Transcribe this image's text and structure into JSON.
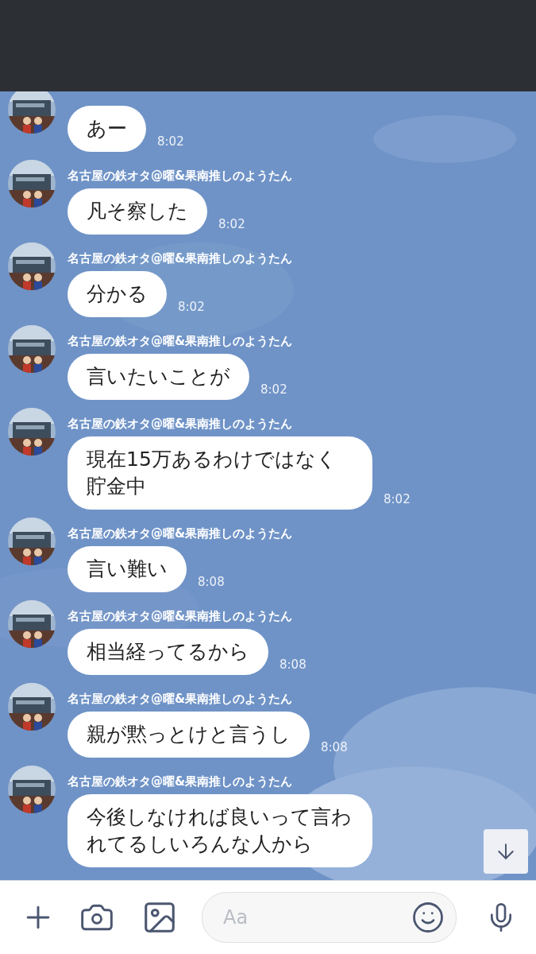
{
  "messages": [
    {
      "text": "あー",
      "time": "8:02"
    },
    {
      "sender": "名古屋の鉄オタ@曜&果南推しのようたん",
      "text": "凡そ察した",
      "time": "8:02"
    },
    {
      "sender": "名古屋の鉄オタ@曜&果南推しのようたん",
      "text": "分かる",
      "time": "8:02"
    },
    {
      "sender": "名古屋の鉄オタ@曜&果南推しのようたん",
      "text": "言いたいことが",
      "time": "8:02"
    },
    {
      "sender": "名古屋の鉄オタ@曜&果南推しのようたん",
      "text": "現在15万あるわけではなく貯金中",
      "time": "8:02"
    },
    {
      "sender": "名古屋の鉄オタ@曜&果南推しのようたん",
      "text": "言い難い",
      "time": "8:08"
    },
    {
      "sender": "名古屋の鉄オタ@曜&果南推しのようたん",
      "text": "相当経ってるから",
      "time": "8:08"
    },
    {
      "sender": "名古屋の鉄オタ@曜&果南推しのようたん",
      "text": "親が黙っとけと言うし",
      "time": "8:08"
    },
    {
      "sender": "名古屋の鉄オタ@曜&果南推しのようたん",
      "text": "今後しなければ良いって言われてるしいろんな人から"
    }
  ],
  "composer": {
    "placeholder": "Aa"
  }
}
